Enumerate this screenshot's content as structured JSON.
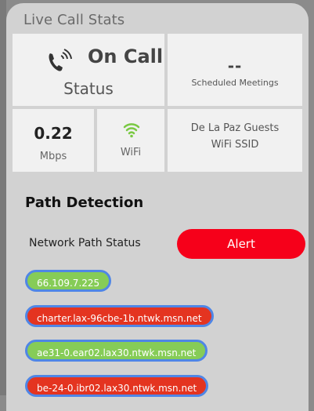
{
  "panel": {
    "title": "Live Call Stats"
  },
  "call_status": {
    "state": "On Call",
    "label": "Status"
  },
  "scheduled_meetings": {
    "value": "--",
    "label": "Scheduled Meetings"
  },
  "bandwidth": {
    "value": "0.22",
    "unit": "Mbps"
  },
  "connection": {
    "type_label": "WiFi",
    "icon": "wifi-icon",
    "icon_color": "#7ac943"
  },
  "ssid": {
    "name": "De La Paz Guests",
    "label": "WiFi SSID"
  },
  "path_detection": {
    "title": "Path Detection",
    "status_label": "Network Path Status",
    "status_value": "Alert",
    "status_color": "#f6001a",
    "hops": [
      {
        "host": "66.109.7.225",
        "status": "ok"
      },
      {
        "host": "charter.lax-96cbe-1b.ntwk.msn.net",
        "status": "alert"
      },
      {
        "host": "ae31-0.ear02.lax30.ntwk.msn.net",
        "status": "ok"
      },
      {
        "host": "be-24-0.ibr02.lax30.ntwk.msn.net",
        "status": "alert"
      }
    ]
  },
  "colors": {
    "ok": "#86cc57",
    "alert": "#e43420",
    "outline": "#4f86e6"
  }
}
